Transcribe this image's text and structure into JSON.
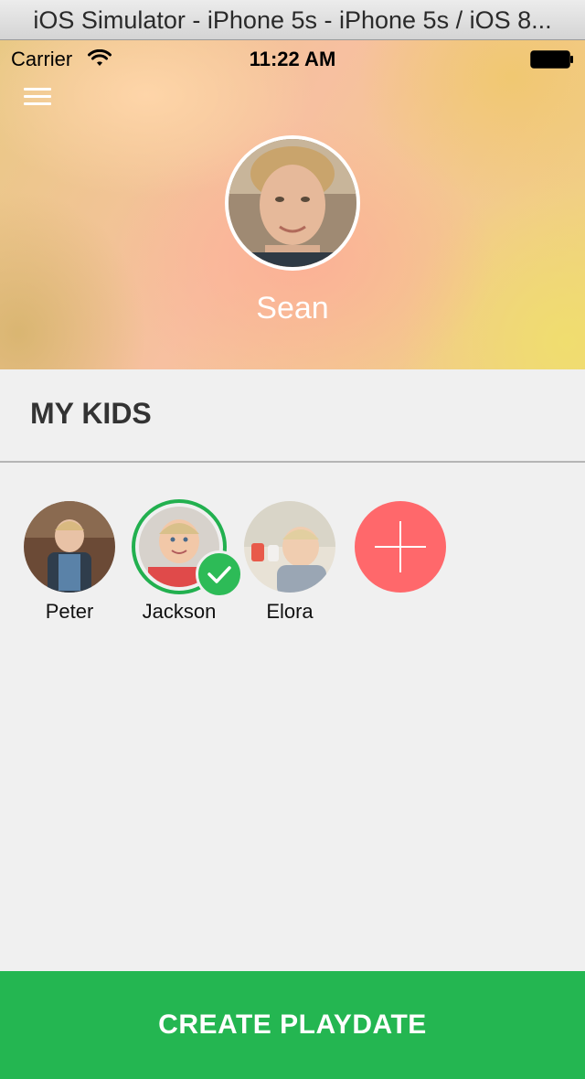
{
  "simulator": {
    "title": "iOS Simulator - iPhone 5s - iPhone 5s / iOS 8..."
  },
  "status_bar": {
    "carrier": "Carrier",
    "time": "11:22 AM"
  },
  "profile": {
    "name": "Sean"
  },
  "section": {
    "title": "MY KIDS"
  },
  "kids": [
    {
      "name": "Peter",
      "selected": false
    },
    {
      "name": "Jackson",
      "selected": true
    },
    {
      "name": "Elora",
      "selected": false
    }
  ],
  "colors": {
    "accent_green": "#24b651",
    "add_button_red": "#ff686b",
    "background": "#f0f0f0"
  },
  "icons": {
    "menu": "hamburger-menu-icon",
    "wifi": "wifi-icon",
    "battery": "battery-icon",
    "check": "check-icon",
    "add": "plus-icon"
  },
  "footer": {
    "create_label": "CREATE PLAYDATE"
  }
}
